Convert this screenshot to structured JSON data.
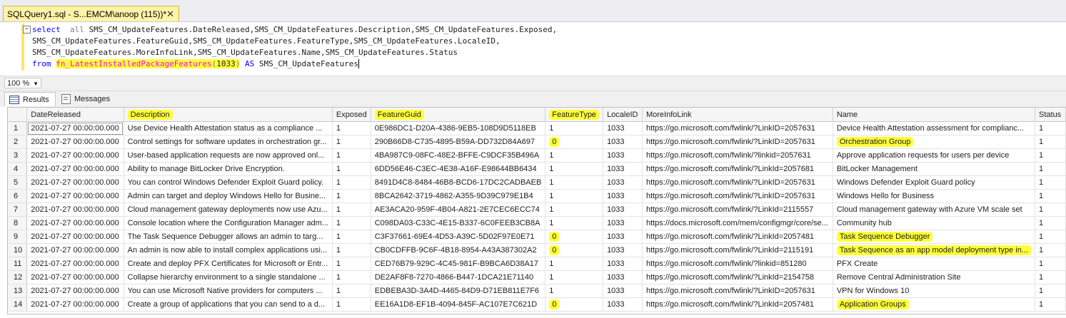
{
  "window": {
    "tab_title": "SQLQuery1.sql - S...EMCM\\anoop (115))*",
    "close_glyph": "✕"
  },
  "editor": {
    "collapse_glyph": "−",
    "kw_select": "select",
    "kw_all": "all",
    "line1_rest": "SMS_CM_UpdateFeatures.DateReleased,SMS_CM_UpdateFeatures.Description,SMS_CM_UpdateFeatures.Exposed,",
    "line2": "SMS_CM_UpdateFeatures.FeatureGuid,SMS_CM_UpdateFeatures.FeatureType,SMS_CM_UpdateFeatures.LocaleID,",
    "line3": "SMS_CM_UpdateFeatures.MoreInfoLink,SMS_CM_UpdateFeatures.Name,SMS_CM_UpdateFeatures.Status",
    "kw_from": "from",
    "fn_name": "fn_LatestInstalledPackageFeatures",
    "fn_open": "(",
    "fn_arg": "1033",
    "fn_close": ")",
    "kw_as": "AS",
    "alias": "SMS_CM_UpdateFeatures"
  },
  "zoom": {
    "value": "100 %"
  },
  "results_tabs": {
    "results_label": "Results",
    "messages_label": "Messages"
  },
  "grid": {
    "columns": [
      "",
      "DateReleased",
      "Description",
      "Exposed",
      "FeatureGuid",
      "FeatureType",
      "LocaleID",
      "MoreInfoLink",
      "Name",
      "Status"
    ],
    "highlighted_columns": [
      "Description",
      "FeatureGuid",
      "FeatureType"
    ],
    "rows": [
      [
        "1",
        "2021-07-27 00:00:00.000",
        "Use Device Health Attestation status as a compliance ...",
        "1",
        "0E986DC1-D20A-4386-9EB5-108D9D5118EB",
        "1",
        "1033",
        "https://go.microsoft.com/fwlink/?LinkID=2057631",
        "Device Health Attestation assessment for complianc...",
        "1"
      ],
      [
        "2",
        "2021-07-27 00:00:00.000",
        "Control settings for software updates in orchestration gr...",
        "1",
        "290B66D8-C735-4895-B59A-DD732D84A697",
        "0",
        "1033",
        "https://go.microsoft.com/fwlink/?LinkID=2057631",
        "Orchestration Group",
        "1"
      ],
      [
        "3",
        "2021-07-27 00:00:00.000",
        "User-based application requests are now approved onl...",
        "1",
        "4BA987C9-08FC-48E2-BFFE-C9DCF35B496A",
        "1",
        "1033",
        "https://go.microsoft.com/fwlink/?linkid=2057631",
        "Approve application requests for users per device",
        "1"
      ],
      [
        "4",
        "2021-07-27 00:00:00.000",
        "Ability to manage BitLocker Drive Encryption.",
        "1",
        "6DD56E46-C3EC-4E38-A16F-E98644BB6434",
        "1",
        "1033",
        "https://go.microsoft.com/fwlink/?LinkId=2057681",
        "BitLocker Management",
        "1"
      ],
      [
        "5",
        "2021-07-27 00:00:00.000",
        "You can control Windows Defender Exploit Guard policy.",
        "1",
        "8491D4C8-8484-46B8-BCD6-17DC2CADBAEB",
        "1",
        "1033",
        "https://go.microsoft.com/fwlink/?LinkID=2057631",
        "Windows Defender Exploit Guard policy",
        "1"
      ],
      [
        "6",
        "2021-07-27 00:00:00.000",
        "Admin can target and deploy Windows Hello for Busine...",
        "1",
        "8BCA2642-3719-4862-A355-9D39C979E1B4",
        "1",
        "1033",
        "https://go.microsoft.com/fwlink/?LinkID=2057631",
        "Windows Hello for Business",
        "1"
      ],
      [
        "7",
        "2021-07-27 00:00:00.000",
        "Cloud management gateway deployments now use Azu...",
        "1",
        "AE3ACA20-959F-4B04-A821-2E7CEC6ECC74",
        "1",
        "1033",
        "https://go.microsoft.com/fwlink/?LinkId=2115557",
        "Cloud management gateway with Azure VM scale set",
        "1"
      ],
      [
        "8",
        "2021-07-27 00:00:00.000",
        "Console location where the Configuration Manager adm...",
        "1",
        "C098DA03-C33C-4E15-B337-6C0FEEB3CB8A",
        "1",
        "1033",
        "https://docs.microsoft.com/mem/configmgr/core/se...",
        "Community hub",
        "1"
      ],
      [
        "9",
        "2021-07-27 00:00:00.000",
        "The Task Sequence Debugger allows an admin to targ...",
        "1",
        "C3F37661-69E4-4D53-A39C-5D02F97E0E71",
        "0",
        "1033",
        "https://go.microsoft.com/fwlink/?LinkId=2057481",
        "Task Sequence Debugger",
        "1"
      ],
      [
        "10",
        "2021-07-27 00:00:00.000",
        "An admin is now able to install complex applications usi...",
        "1",
        "CB0CDFFB-9C6F-4B18-8954-A43A387302A2",
        "0",
        "1033",
        "https://go.microsoft.com/fwlink/?LinkId=2115191",
        "Task Sequence as an app model deployment type in...",
        "1"
      ],
      [
        "11",
        "2021-07-27 00:00:00.000",
        "Create and deploy PFX Certificates for Microsoft or Entr...",
        "1",
        "CED76B79-929C-4C45-981F-B9BCA6D38A17",
        "1",
        "1033",
        "https://go.microsoft.com/fwlink/?linkid=851280",
        "PFX Create",
        "1"
      ],
      [
        "12",
        "2021-07-27 00:00:00.000",
        "Collapse hierarchy environment to a single standalone ...",
        "1",
        "DE2AF8F8-7270-4866-B447-1DCA21E71140",
        "1",
        "1033",
        "https://go.microsoft.com/fwlink/?LinkId=2154758",
        "Remove Central Administration Site",
        "1"
      ],
      [
        "13",
        "2021-07-27 00:00:00.000",
        "You can use Microsoft Native providers for computers ...",
        "1",
        "EDBEBA3D-3A4D-4465-84D9-D71EB811E7F6",
        "1",
        "1033",
        "https://go.microsoft.com/fwlink/?LinkID=2057631",
        "VPN for Windows 10",
        "1"
      ],
      [
        "14",
        "2021-07-27 00:00:00.000",
        "Create a group of applications that you can send to a d...",
        "1",
        "EE16A1D8-EF1B-4094-845F-AC107E7C621D",
        "0",
        "1033",
        "https://go.microsoft.com/fwlink/?LinkId=2057481",
        "Application Groups",
        "1"
      ]
    ],
    "highlighted_cells": [
      [
        2,
        5
      ],
      [
        2,
        8
      ],
      [
        9,
        5
      ],
      [
        9,
        8
      ],
      [
        10,
        5
      ],
      [
        10,
        8
      ],
      [
        14,
        5
      ],
      [
        14,
        8
      ]
    ],
    "highlight_color": "#ffff3a"
  }
}
